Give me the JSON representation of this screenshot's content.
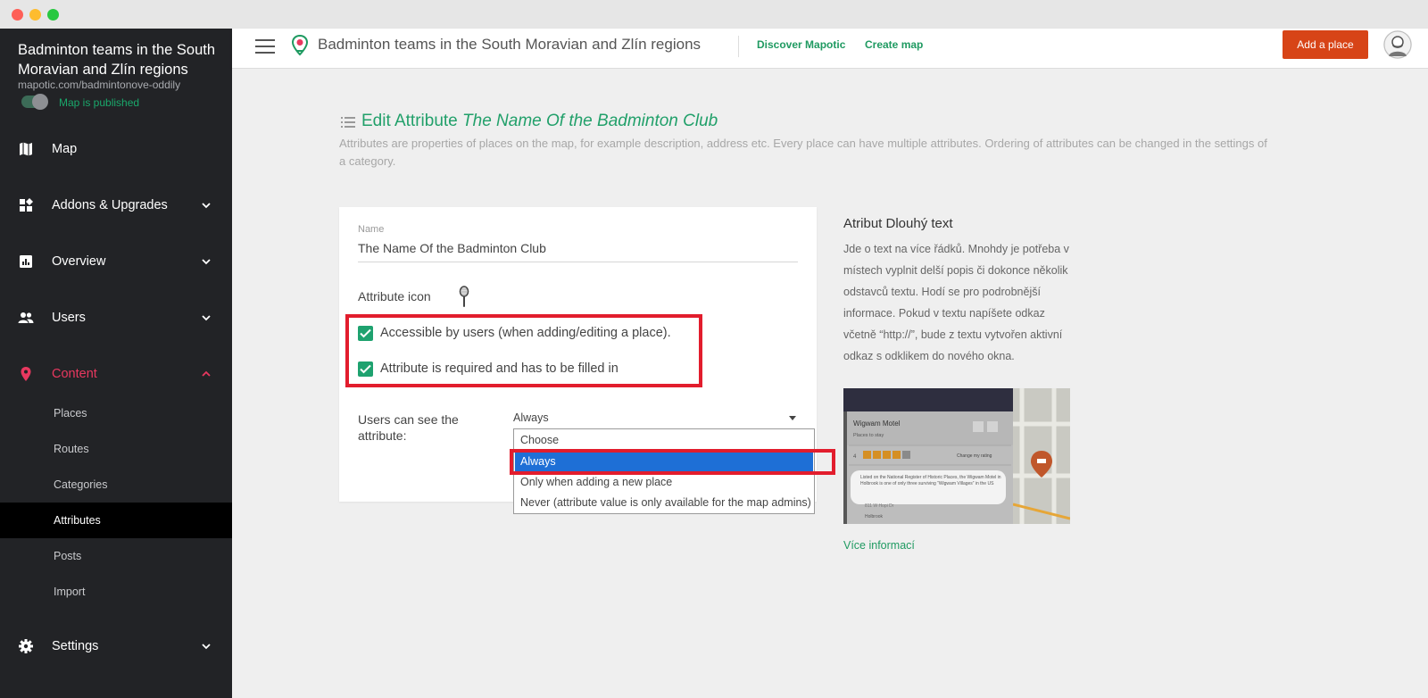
{
  "sidebar": {
    "map_title": "Badminton teams in the South Moravian and Zlín regions",
    "map_url": "mapotic.com/badmintonove-oddily",
    "published_label": "Map is published",
    "items": [
      {
        "label": "Map",
        "icon": "map-icon"
      },
      {
        "label": "Addons & Upgrades",
        "icon": "addons-icon"
      },
      {
        "label": "Overview",
        "icon": "chart-icon"
      },
      {
        "label": "Users",
        "icon": "users-icon"
      },
      {
        "label": "Content",
        "icon": "pin-icon"
      },
      {
        "label": "Settings",
        "icon": "gear-icon"
      }
    ],
    "content_subitems": [
      "Places",
      "Routes",
      "Categories",
      "Attributes",
      "Posts",
      "Import"
    ],
    "active_color": "#e8385f"
  },
  "topbar": {
    "title": "Badminton teams in the South Moravian and Zlín regions",
    "discover": "Discover Mapotic",
    "create": "Create map",
    "add_place": "Add a place"
  },
  "main": {
    "heading_prefix": "Edit Attribute",
    "heading_name": "The Name Of the Badminton Club",
    "description": "Attributes are properties of places on the map, for example description, address etc. Every place can have multiple attributes. Ordering of attributes can be changed in the settings of a category.",
    "form": {
      "name_label": "Name",
      "name_value": "The Name Of the Badminton Club",
      "icon_label": "Attribute icon",
      "checkbox_accessible": "Accessible by users (when adding/editing a place).",
      "checkbox_required": "Attribute is required and has to be filled in",
      "visibility_label": "Users can see the attribute:",
      "visibility_value": "Always",
      "options": [
        "Choose",
        "Always",
        "Only when adding a new place",
        "Never (attribute value is only available for the map admins)"
      ]
    },
    "info": {
      "title": "Atribut Dlouhý text",
      "text": "Jde o text na více řádků. Mnohdy je potřeba v místech vyplnit delší popis či dokonce několik odstavců textu. Hodí se pro podrobnější informace. Pokud v textu napíšete odkaz včetně “http://”, bude z textu vytvořen aktivní odkaz s odklikem do nového okna.",
      "more": "Více informací",
      "preview": {
        "place_name": "Wigwam Motel",
        "place_sub": "Places to stay",
        "rating_num": "4",
        "rating_link": "Change my rating",
        "blurb": "Listed on the National Register of Historic Places, the Wigwam Motel in Holbrook is one of only three surviving “Wigwam Villages” in the US",
        "address": "811 W Hopi Dr",
        "city": "Holbrook"
      }
    }
  },
  "colors": {
    "accent_green": "#1f9a61",
    "highlight_red": "#e21d2d",
    "button_orange": "#d74417",
    "sidebar_bg": "#222326"
  }
}
